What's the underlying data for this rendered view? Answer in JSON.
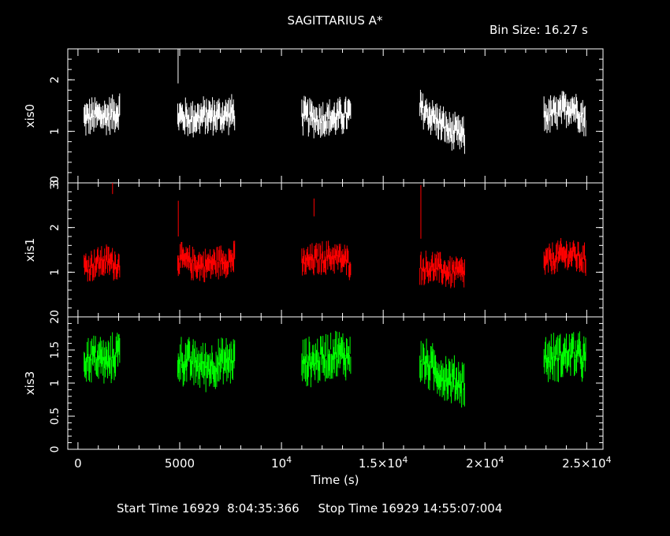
{
  "header": {
    "title": "SAGITTARIUS A*",
    "bin_size": "Bin Size: 16.27 s"
  },
  "footer": {
    "times": "Start Time 16929  8:04:35:366     Stop Time 16929 14:55:07:004"
  },
  "chart_data": {
    "type": "line",
    "style": "binned light curve with vertical error bars",
    "title": "SAGITTARIUS A*",
    "xlabel": "Time (s)",
    "xlim": [
      -500,
      25800
    ],
    "x_ticks": [
      {
        "value": 0,
        "label": "0"
      },
      {
        "value": 5000,
        "label": "5000"
      },
      {
        "value": 10000,
        "label": "10",
        "exp": "4"
      },
      {
        "value": 15000,
        "label": "1.5×10",
        "exp": "4"
      },
      {
        "value": 20000,
        "label": "2×10",
        "exp": "4"
      },
      {
        "value": 25000,
        "label": "2.5×10",
        "exp": "4"
      }
    ],
    "grid": false,
    "observation_segments": [
      [
        300,
        2050
      ],
      [
        4900,
        7700
      ],
      [
        11000,
        13400
      ],
      [
        16800,
        19000
      ],
      [
        22900,
        24950
      ]
    ],
    "panels": [
      {
        "name": "xis0",
        "ylabel": "xis0",
        "color": "#ffffff",
        "ylim": [
          0,
          2.6
        ],
        "y_ticks": [
          1,
          2
        ],
        "y_tick_labels": [
          "1",
          "2"
        ],
        "bottom_tick_label": "30",
        "segments": [
          {
            "t": [
              300,
              2050
            ],
            "y": [
              1.25,
              1.3,
              1.3,
              1.4
            ],
            "err": 0.17
          },
          {
            "t": [
              4900,
              7700
            ],
            "y": [
              1.3,
              1.25,
              1.3,
              1.3,
              1.35
            ],
            "err": 0.17
          },
          {
            "t": [
              11000,
              13400
            ],
            "y": [
              1.3,
              1.25,
              1.25,
              1.35
            ],
            "err": 0.17
          },
          {
            "t": [
              16800,
              19000
            ],
            "y": [
              1.45,
              1.25,
              1.0,
              0.9
            ],
            "err": 0.17
          },
          {
            "t": [
              22900,
              24950
            ],
            "y": [
              1.3,
              1.35,
              1.5,
              1.25
            ],
            "err": 0.17
          }
        ],
        "spikes": [
          {
            "t": 4920,
            "y": 2.28,
            "err": 0.35
          }
        ]
      },
      {
        "name": "xis1",
        "ylabel": "xis1",
        "color": "#ff0000",
        "ylim": [
          0,
          3
        ],
        "y_ticks": [
          1,
          2,
          3
        ],
        "y_tick_labels": [
          "1",
          "2",
          "3"
        ],
        "bottom_tick_label": "20",
        "segments": [
          {
            "t": [
              300,
              2050
            ],
            "y": [
              1.1,
              1.2,
              1.25,
              1.15
            ],
            "err": 0.17
          },
          {
            "t": [
              4900,
              7700
            ],
            "y": [
              1.3,
              1.2,
              1.15,
              1.25,
              1.3
            ],
            "err": 0.17
          },
          {
            "t": [
              11000,
              13400
            ],
            "y": [
              1.2,
              1.3,
              1.35,
              1.2
            ],
            "err": 0.17
          },
          {
            "t": [
              16800,
              19000
            ],
            "y": [
              1.1,
              1.1,
              1.0,
              1.0
            ],
            "err": 0.17
          },
          {
            "t": [
              22900,
              24950
            ],
            "y": [
              1.2,
              1.35,
              1.4,
              1.25
            ],
            "err": 0.17
          }
        ],
        "spikes": [
          {
            "t": 1700,
            "y": 2.9,
            "err": 0.15
          },
          {
            "t": 4930,
            "y": 2.2,
            "err": 0.4
          },
          {
            "t": 7650,
            "y": 1.35,
            "err": 0.35
          },
          {
            "t": 11600,
            "y": 2.45,
            "err": 0.2
          },
          {
            "t": 16850,
            "y": 2.35,
            "err": 0.6
          }
        ]
      },
      {
        "name": "xis3",
        "ylabel": "xis3",
        "color": "#00ff00",
        "ylim": [
          0,
          2
        ],
        "y_ticks": [
          0,
          0.5,
          1,
          1.5
        ],
        "y_tick_labels": [
          "0",
          "0.5",
          "1",
          "1.5"
        ],
        "bottom_tick_label": "",
        "segments": [
          {
            "t": [
              300,
              2050
            ],
            "y": [
              1.35,
              1.4,
              1.3,
              1.5
            ],
            "err": 0.16
          },
          {
            "t": [
              4900,
              7700
            ],
            "y": [
              1.35,
              1.3,
              1.25,
              1.3,
              1.35
            ],
            "err": 0.16
          },
          {
            "t": [
              11000,
              13400
            ],
            "y": [
              1.3,
              1.35,
              1.45,
              1.4
            ],
            "err": 0.16
          },
          {
            "t": [
              16800,
              19000
            ],
            "y": [
              1.35,
              1.2,
              1.05,
              1.0
            ],
            "err": 0.16
          },
          {
            "t": [
              22900,
              24950
            ],
            "y": [
              1.35,
              1.4,
              1.45,
              1.35
            ],
            "err": 0.16
          }
        ],
        "spikes": []
      }
    ]
  }
}
